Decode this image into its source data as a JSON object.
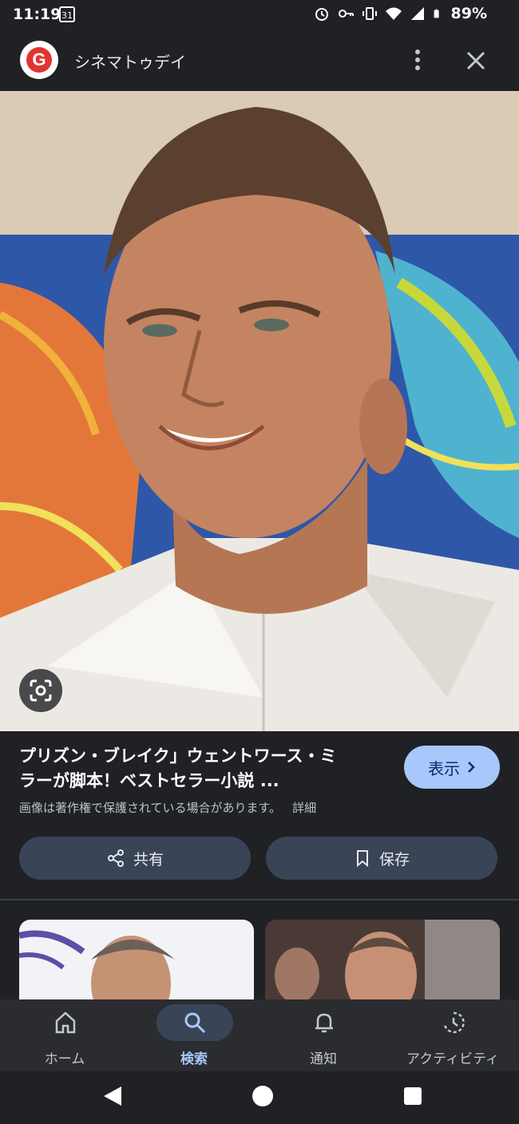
{
  "status_bar": {
    "time": "11:19",
    "calendar_day": "31",
    "battery": "89%"
  },
  "header": {
    "logo_letter": "G",
    "site_name": "シネマトゥデイ"
  },
  "result": {
    "title_line1": "プリズン・ブレイク」ウェントワース・ミ",
    "title_line2": "ラーが脚本！ベストセラー小説 ...",
    "visit_label": "表示",
    "copyright": "画像は著作権で保護されている場合があります。",
    "detail_link": "詳細"
  },
  "actions": {
    "share_label": "共有",
    "save_label": "保存"
  },
  "bottom_nav": [
    {
      "label": "ホーム",
      "icon": "home-icon"
    },
    {
      "label": "検索",
      "icon": "search-icon",
      "active": true
    },
    {
      "label": "通知",
      "icon": "bell-icon"
    },
    {
      "label": "アクティビティ",
      "icon": "activity-icon"
    }
  ],
  "colors": {
    "accent": "#a8c7fa",
    "background": "#1f2125",
    "button": "#394457"
  }
}
